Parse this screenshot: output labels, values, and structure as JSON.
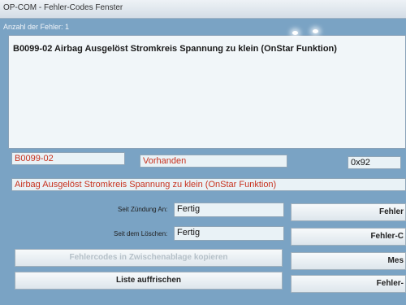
{
  "window": {
    "title": "OP-COM - Fehler-Codes Fenster"
  },
  "summary": {
    "error_count_label": "Anzahl der Fehler: 1"
  },
  "fault_list": {
    "entries": [
      "B0099-02 Airbag Ausgelöst Stromkreis Spannung zu klein (OnStar Funktion)"
    ]
  },
  "detail": {
    "code": "B0099-02",
    "status": "Vorhanden",
    "hex": "0x92",
    "description": "Airbag Ausgelöst Stromkreis Spannung zu klein (OnStar Funktion)"
  },
  "status_rows": {
    "since_ignition_label": "Seit Zündung An:",
    "since_ignition_value": "Fertig",
    "since_clear_label": "Seit dem Löschen:",
    "since_clear_value": "Fertig"
  },
  "buttons": {
    "copy_clipboard": "Fehlercodes in Zwischenablage kopieren",
    "refresh_list": "Liste auffrischen",
    "right_1": "Fehler",
    "right_2": "Fehler-C",
    "right_3": "Mes",
    "right_4": "Fehler-"
  },
  "colors": {
    "background": "#7aa3c4",
    "field": "#e9f2f6",
    "error_text": "#c8321e"
  }
}
